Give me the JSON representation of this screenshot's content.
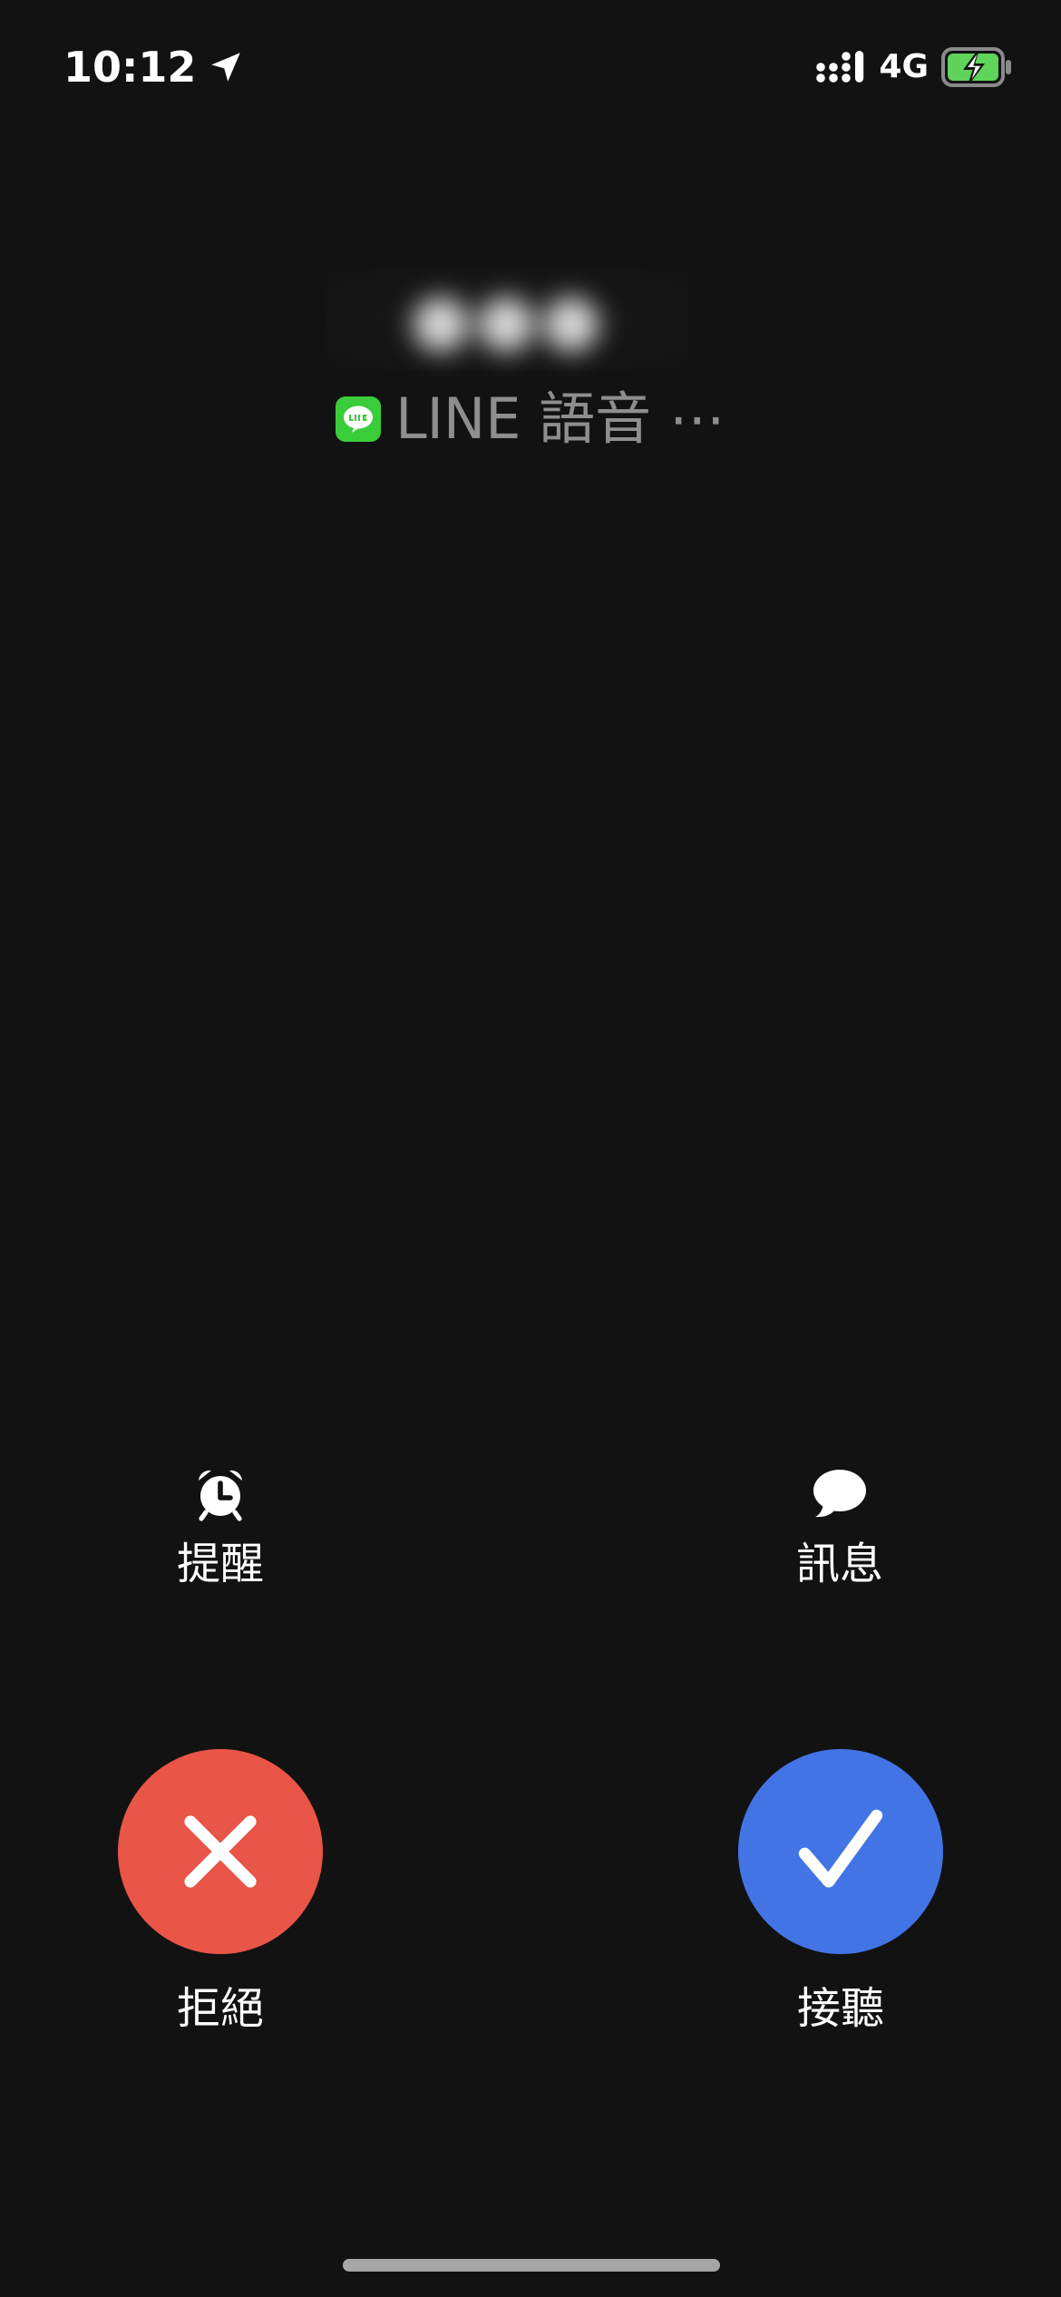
{
  "status_bar": {
    "time": "10:12",
    "network": "4G",
    "icons": {
      "location": "location-arrow-icon",
      "signal": "cellular-signal-icon",
      "battery": "battery-charging-icon"
    },
    "colors": {
      "battery_fill": "#5fd35b"
    }
  },
  "caller": {
    "name": "●●●",
    "source_text": "LINE 語音 ⋯",
    "app_icon": "line-app-icon",
    "app_icon_color": "#3acd3a"
  },
  "actions": {
    "remind": {
      "label": "提醒",
      "icon": "alarm-clock-icon"
    },
    "message": {
      "label": "訊息",
      "icon": "speech-bubble-icon"
    },
    "decline": {
      "label": "拒絕",
      "icon": "x-icon",
      "color": "#e95546"
    },
    "accept": {
      "label": "接聽",
      "icon": "checkmark-icon",
      "color": "#4374e6"
    }
  }
}
